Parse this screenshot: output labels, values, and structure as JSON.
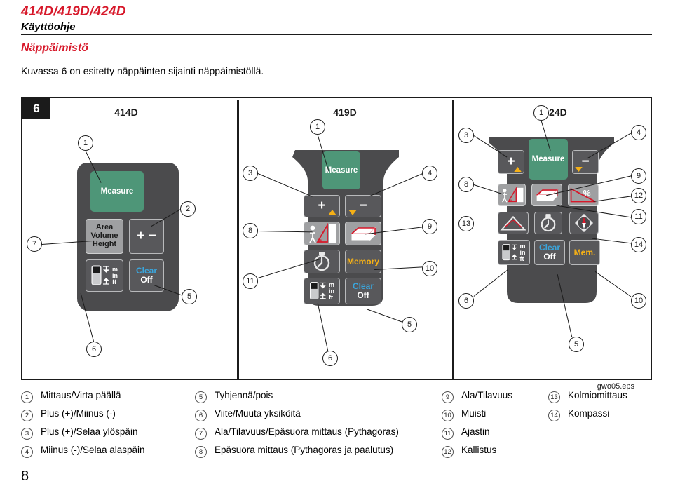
{
  "header": {
    "models": "414D/419D/424D",
    "subtitle": "Käyttöohje"
  },
  "section": {
    "title": "Näppäimistö",
    "intro": "Kuvassa 6 on esitetty näppäinten sijainti näppäimistöllä."
  },
  "figure": {
    "number": "6",
    "eps_label": "gwo05.eps",
    "devices": [
      {
        "name": "414D",
        "keys": {
          "measure": "Measure",
          "area_volume_height": "Area\nVolume\nHeight",
          "plus_minus": "+ −",
          "clear": "Clear",
          "off": "Off",
          "units": [
            "m",
            "in",
            "ft"
          ]
        },
        "callouts": [
          "1",
          "2",
          "7",
          "5",
          "6"
        ]
      },
      {
        "name": "419D",
        "keys": {
          "measure": "Measure",
          "plus": "+",
          "minus": "−",
          "memory": "Memory",
          "clear": "Clear",
          "off": "Off",
          "units": [
            "m",
            "in",
            "ft"
          ]
        },
        "callouts": [
          "1",
          "3",
          "4",
          "8",
          "9",
          "11",
          "10",
          "6",
          "5"
        ]
      },
      {
        "name": "424D",
        "keys": {
          "measure": "Measure",
          "plus": "+",
          "minus": "−",
          "memory": "Mem.",
          "clear": "Clear",
          "off": "Off",
          "percent": "%",
          "units": [
            "m",
            "in",
            "ft"
          ]
        },
        "callouts": [
          "1",
          "3",
          "4",
          "8",
          "9",
          "12",
          "13",
          "11",
          "14",
          "6",
          "5",
          "10"
        ]
      }
    ],
    "icons": {
      "pythagoras": "pythagoras-icon",
      "volume": "volume-box-icon",
      "tilt": "tilt-percent-icon",
      "triangle": "triangle-measure-icon",
      "timer": "stopwatch-icon",
      "compass": "compass-icon",
      "reference": "reference-unit-icon",
      "up_arrow": "scroll-up-arrow-icon",
      "down_arrow": "scroll-down-arrow-icon"
    }
  },
  "legend": {
    "columns": [
      [
        {
          "num": "1",
          "text": "Mittaus/Virta päällä"
        },
        {
          "num": "2",
          "text": "Plus (+)/Miinus (-)"
        },
        {
          "num": "3",
          "text": "Plus (+)/Selaa ylöspäin"
        },
        {
          "num": "4",
          "text": "Miinus (-)/Selaa alaspäin"
        }
      ],
      [
        {
          "num": "5",
          "text": "Tyhjennä/pois"
        },
        {
          "num": "6",
          "text": "Viite/Muuta yksiköitä"
        },
        {
          "num": "7",
          "text": "Ala/Tilavuus/Epäsuora mittaus (Pythagoras)"
        },
        {
          "num": "8",
          "text": "Epäsuora mittaus (Pythagoras ja paalutus)"
        }
      ],
      [
        {
          "num": "9",
          "text": "Ala/Tilavuus"
        },
        {
          "num": "10",
          "text": "Muisti"
        },
        {
          "num": "11",
          "text": "Ajastin"
        },
        {
          "num": "12",
          "text": "Kallistus"
        }
      ],
      [
        {
          "num": "13",
          "text": "Kolmiomittaus"
        },
        {
          "num": "14",
          "text": "Kompassi"
        }
      ]
    ]
  },
  "footer": {
    "page": "8"
  },
  "colors": {
    "brand_red": "#d7182a",
    "measure_green": "#4e9678",
    "clear_blue": "#3aa5dc",
    "memory_amber": "#f5b016",
    "body_dark": "#4b4b4d",
    "key_grey": "#9fa0a2"
  }
}
